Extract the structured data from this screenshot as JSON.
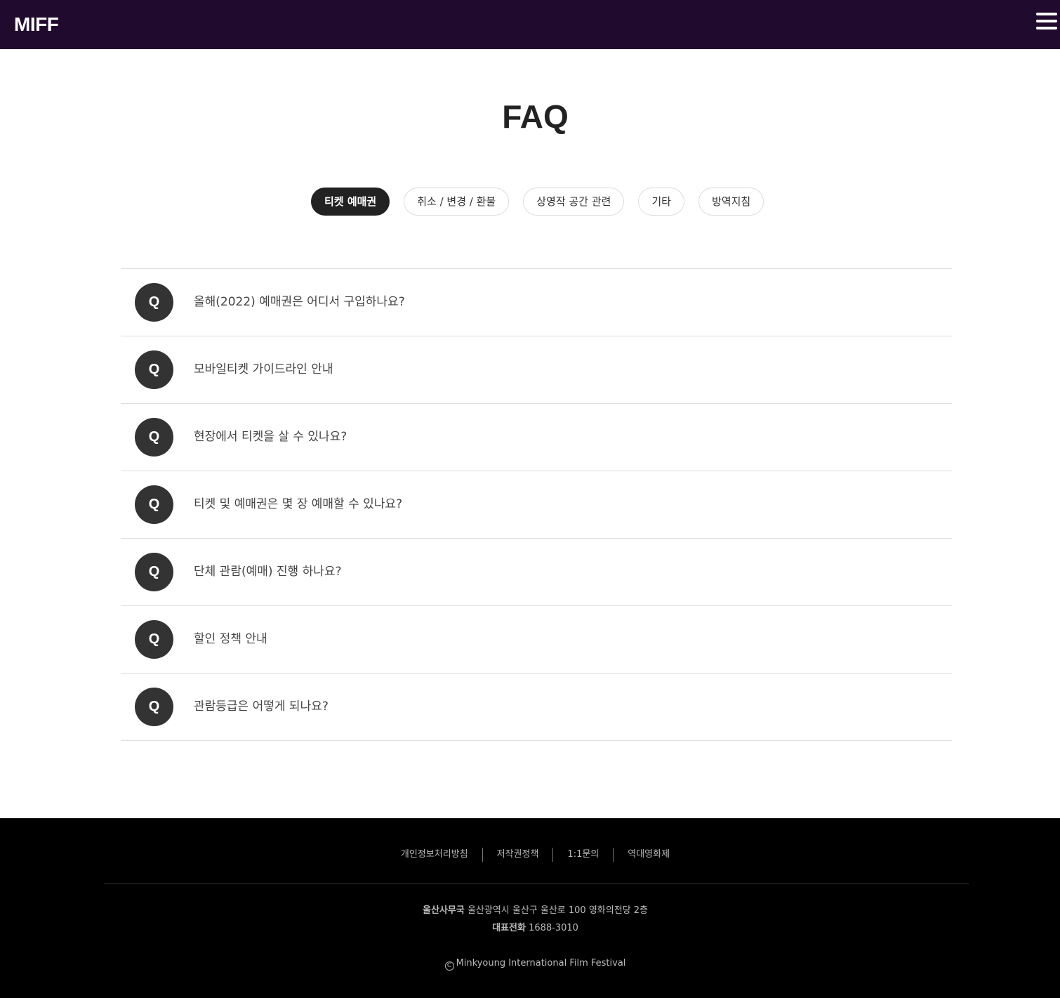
{
  "header": {
    "logo": "MIFF",
    "menu_icon": "hamburger-menu-icon"
  },
  "page": {
    "title": "FAQ"
  },
  "tabs": [
    {
      "label": "티켓 예매권",
      "active": true
    },
    {
      "label": "취소 / 변경 / 환불",
      "active": false
    },
    {
      "label": "상영작 공간 관련",
      "active": false
    },
    {
      "label": "기타",
      "active": false
    },
    {
      "label": "방역지침",
      "active": false
    }
  ],
  "faq": {
    "badge": "Q",
    "items": [
      {
        "question": "올해(2022) 예매권은 어디서 구입하나요?"
      },
      {
        "question": "모바일티켓 가이드라인 안내"
      },
      {
        "question": "현장에서 티켓을 살 수 있나요?"
      },
      {
        "question": "티켓 및 예매권은 몇 장 예매할 수 있나요?"
      },
      {
        "question": "단체 관람(예매) 진행 하나요?"
      },
      {
        "question": "할인 정책 안내"
      },
      {
        "question": "관람등급은 어떻게 되나요?"
      }
    ]
  },
  "footer": {
    "links": [
      "개인정보처리방침",
      "저작권정책",
      "1:1문의",
      "역대영화제"
    ],
    "office_label": "울산사무국",
    "office_address": "울산광역시 울산구 울산로 100 영화의전당 2층",
    "phone_label": "대표전화",
    "phone_number": "1688-3010",
    "copyright_symbol": "C",
    "copyright_text": "Minkyoung International Film Festival"
  },
  "colors": {
    "header_bg": "#200a2e",
    "active_tab_bg": "#222222",
    "badge_bg": "#333333",
    "footer_bg": "#000000"
  }
}
